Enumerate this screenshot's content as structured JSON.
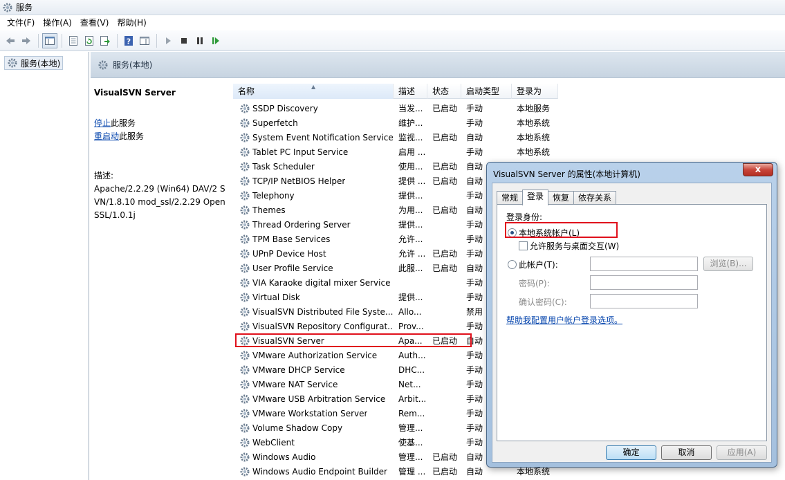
{
  "window": {
    "title": "服务"
  },
  "menu": [
    "文件(F)",
    "操作(A)",
    "查看(V)",
    "帮助(H)"
  ],
  "tree": {
    "root": "服务(本地)"
  },
  "content_header": {
    "title": "服务(本地)"
  },
  "detail": {
    "service_name": "VisualSVN Server",
    "stop_link": "停止",
    "stop_suffix": "此服务",
    "restart_link": "重启动",
    "restart_suffix": "此服务",
    "desc_label": "描述:",
    "desc_text": "Apache/2.2.29 (Win64) DAV/2 SVN/1.8.10 mod_ssl/2.2.29 OpenSSL/1.0.1j"
  },
  "columns": {
    "name": "名称",
    "desc": "描述",
    "status": "状态",
    "start": "启动类型",
    "logon": "登录为"
  },
  "rows": [
    {
      "name": "SSDP Discovery",
      "desc": "当发...",
      "status": "已启动",
      "start": "手动",
      "logon": "本地服务"
    },
    {
      "name": "Superfetch",
      "desc": "维护...",
      "status": "",
      "start": "手动",
      "logon": "本地系统"
    },
    {
      "name": "System Event Notification Service",
      "desc": "监视...",
      "status": "已启动",
      "start": "自动",
      "logon": "本地系统"
    },
    {
      "name": "Tablet PC Input Service",
      "desc": "启用 ...",
      "status": "",
      "start": "手动",
      "logon": "本地系统"
    },
    {
      "name": "Task Scheduler",
      "desc": "使用...",
      "status": "已启动",
      "start": "自动",
      "logon": ""
    },
    {
      "name": "TCP/IP NetBIOS Helper",
      "desc": "提供 ...",
      "status": "已启动",
      "start": "自动",
      "logon": ""
    },
    {
      "name": "Telephony",
      "desc": "提供...",
      "status": "",
      "start": "手动",
      "logon": ""
    },
    {
      "name": "Themes",
      "desc": "为用...",
      "status": "已启动",
      "start": "自动",
      "logon": ""
    },
    {
      "name": "Thread Ordering Server",
      "desc": "提供...",
      "status": "",
      "start": "手动",
      "logon": ""
    },
    {
      "name": "TPM Base Services",
      "desc": "允许...",
      "status": "",
      "start": "手动",
      "logon": ""
    },
    {
      "name": "UPnP Device Host",
      "desc": "允许 ...",
      "status": "已启动",
      "start": "手动",
      "logon": ""
    },
    {
      "name": "User Profile Service",
      "desc": "此服...",
      "status": "已启动",
      "start": "自动",
      "logon": ""
    },
    {
      "name": "VIA Karaoke digital mixer Service",
      "desc": "",
      "status": "",
      "start": "手动",
      "logon": ""
    },
    {
      "name": "Virtual Disk",
      "desc": "提供...",
      "status": "",
      "start": "手动",
      "logon": ""
    },
    {
      "name": "VisualSVN Distributed File Syste...",
      "desc": "Allo...",
      "status": "",
      "start": "禁用",
      "logon": ""
    },
    {
      "name": "VisualSVN Repository Configurat...",
      "desc": "Prov...",
      "status": "",
      "start": "手动",
      "logon": ""
    },
    {
      "name": "VisualSVN Server",
      "desc": "Apa...",
      "status": "已启动",
      "start": "自动",
      "logon": ""
    },
    {
      "name": "VMware Authorization Service",
      "desc": "Auth...",
      "status": "",
      "start": "手动",
      "logon": ""
    },
    {
      "name": "VMware DHCP Service",
      "desc": "DHC...",
      "status": "",
      "start": "手动",
      "logon": ""
    },
    {
      "name": "VMware NAT Service",
      "desc": "Net...",
      "status": "",
      "start": "手动",
      "logon": ""
    },
    {
      "name": "VMware USB Arbitration Service",
      "desc": "Arbit...",
      "status": "",
      "start": "手动",
      "logon": ""
    },
    {
      "name": "VMware Workstation Server",
      "desc": "Rem...",
      "status": "",
      "start": "手动",
      "logon": ""
    },
    {
      "name": "Volume Shadow Copy",
      "desc": "管理...",
      "status": "",
      "start": "手动",
      "logon": ""
    },
    {
      "name": "WebClient",
      "desc": "使基...",
      "status": "",
      "start": "手动",
      "logon": ""
    },
    {
      "name": "Windows Audio",
      "desc": "管理...",
      "status": "已启动",
      "start": "自动",
      "logon": ""
    },
    {
      "name": "Windows Audio Endpoint Builder",
      "desc": "管理 ...",
      "status": "已启动",
      "start": "自动",
      "logon": "本地系统"
    }
  ],
  "dialog": {
    "title": "VisualSVN Server 的属性(本地计算机)",
    "close": "x",
    "tabs": [
      "常规",
      "登录",
      "恢复",
      "依存关系"
    ],
    "logon_as": "登录身份:",
    "local_system": "本地系统帐户(L)",
    "allow_desktop": "允许服务与桌面交互(W)",
    "this_account": "此帐户(T):",
    "browse": "浏览(B)...",
    "password": "密码(P):",
    "confirm_password": "确认密码(C):",
    "help_link": "帮助我配置用户帐户登录选项。",
    "ok": "确定",
    "cancel": "取消",
    "apply": "应用(A)"
  },
  "colors": {
    "highlight": "#e0101c",
    "header_bg": "#c7d4e1",
    "link": "#0645ad"
  }
}
